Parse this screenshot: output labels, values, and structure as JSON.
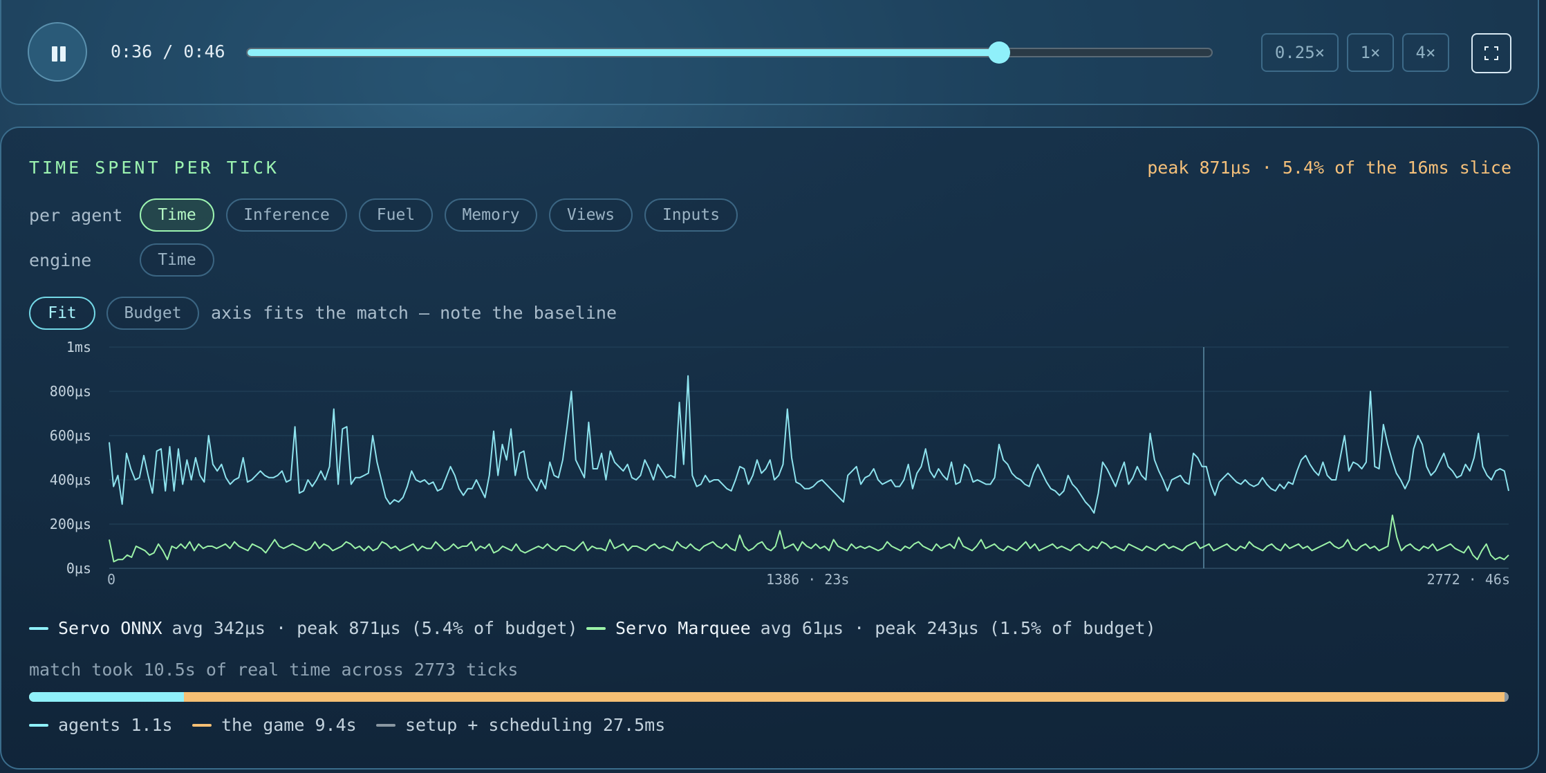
{
  "player": {
    "time_readout": "0:36 / 0:46",
    "progress": 0.78,
    "speeds": [
      {
        "label": "0.25×",
        "active": false
      },
      {
        "label": "1×",
        "active": true
      },
      {
        "label": "4×",
        "active": false
      }
    ]
  },
  "panel": {
    "title": "TIME SPENT PER TICK",
    "peak_text": "peak 871μs · 5.4% of the 16ms slice",
    "per_agent_label": "per agent",
    "per_agent_options": [
      "Time",
      "Inference",
      "Fuel",
      "Memory",
      "Views",
      "Inputs"
    ],
    "per_agent_selected": "Time",
    "engine_label": "engine",
    "engine_options": [
      "Time"
    ],
    "scale_options": [
      "Fit",
      "Budget"
    ],
    "scale_selected": "Fit",
    "scale_note": "axis fits the match — note the baseline"
  },
  "chart_data": {
    "type": "line",
    "y_ticks": [
      "1ms",
      "800μs",
      "600μs",
      "400μs",
      "200μs",
      "0μs"
    ],
    "x_ticks": [
      "0",
      "1386 · 23s",
      "2772 · 46s"
    ],
    "xlim": [
      0,
      2772
    ],
    "ylim": [
      0,
      1000
    ],
    "y_unit": "μs",
    "cursor_x": 2168,
    "grid": true,
    "series": [
      {
        "name": "Servo ONNX",
        "color": "#8ee3ee",
        "values": [
          570,
          370,
          420,
          290,
          520,
          450,
          400,
          410,
          510,
          420,
          340,
          530,
          540,
          350,
          550,
          350,
          540,
          380,
          490,
          400,
          500,
          420,
          390,
          600,
          470,
          440,
          470,
          410,
          380,
          400,
          410,
          500,
          390,
          400,
          420,
          440,
          420,
          410,
          410,
          420,
          440,
          390,
          400,
          640,
          340,
          350,
          400,
          370,
          400,
          440,
          400,
          460,
          720,
          380,
          630,
          640,
          380,
          410,
          410,
          420,
          430,
          600,
          480,
          400,
          320,
          290,
          310,
          300,
          320,
          370,
          440,
          400,
          390,
          400,
          380,
          390,
          350,
          360,
          410,
          460,
          420,
          360,
          330,
          360,
          360,
          400,
          360,
          320,
          420,
          620,
          420,
          560,
          490,
          630,
          420,
          520,
          530,
          410,
          380,
          350,
          400,
          360,
          480,
          420,
          410,
          490,
          640,
          800,
          490,
          450,
          410,
          660,
          450,
          450,
          520,
          400,
          530,
          480,
          460,
          440,
          470,
          410,
          400,
          420,
          490,
          450,
          400,
          470,
          440,
          410,
          420,
          410,
          750,
          470,
          870,
          420,
          370,
          380,
          420,
          390,
          400,
          400,
          380,
          360,
          350,
          400,
          460,
          450,
          380,
          420,
          490,
          430,
          450,
          490,
          400,
          420,
          470,
          720,
          500,
          390,
          380,
          360,
          360,
          370,
          390,
          400,
          380,
          360,
          340,
          320,
          300,
          420,
          440,
          460,
          380,
          410,
          420,
          450,
          400,
          380,
          390,
          400,
          370,
          370,
          400,
          470,
          360,
          430,
          460,
          540,
          440,
          410,
          450,
          420,
          400,
          480,
          380,
          390,
          470,
          450,
          390,
          400,
          390,
          380,
          380,
          410,
          560,
          490,
          470,
          430,
          410,
          400,
          380,
          370,
          430,
          470,
          430,
          390,
          360,
          350,
          330,
          350,
          420,
          380,
          360,
          330,
          300,
          280,
          250,
          340,
          480,
          450,
          410,
          370,
          430,
          480,
          380,
          410,
          460,
          420,
          400,
          610,
          490,
          440,
          400,
          350,
          400,
          410,
          420,
          390,
          380,
          520,
          500,
          460,
          460,
          380,
          330,
          390,
          410,
          430,
          410,
          390,
          380,
          400,
          380,
          370,
          380,
          410,
          380,
          360,
          350,
          380,
          360,
          390,
          380,
          440,
          490,
          510,
          470,
          440,
          420,
          480,
          420,
          400,
          400,
          500,
          600,
          440,
          480,
          470,
          450,
          480,
          800,
          460,
          450,
          650,
          560,
          490,
          430,
          400,
          360,
          400,
          540,
          600,
          560,
          460,
          420,
          440,
          480,
          520,
          460,
          440,
          410,
          420,
          470,
          440,
          500,
          610,
          460,
          420,
          400,
          440,
          450,
          440,
          350
        ],
        "avg": "342μs",
        "peak": "871μs",
        "budget_pct": "5.4%"
      },
      {
        "name": "Servo Marquee",
        "color": "#9cf3a8",
        "values": [
          130,
          30,
          40,
          40,
          60,
          50,
          100,
          90,
          80,
          60,
          70,
          110,
          80,
          40,
          100,
          90,
          110,
          90,
          120,
          80,
          110,
          90,
          100,
          100,
          90,
          100,
          110,
          90,
          120,
          100,
          90,
          80,
          110,
          100,
          90,
          70,
          100,
          130,
          100,
          90,
          100,
          110,
          100,
          90,
          80,
          90,
          120,
          90,
          110,
          100,
          80,
          90,
          100,
          120,
          110,
          90,
          100,
          80,
          100,
          80,
          90,
          120,
          110,
          90,
          100,
          80,
          90,
          100,
          110,
          80,
          100,
          90,
          90,
          120,
          100,
          80,
          90,
          110,
          90,
          100,
          100,
          120,
          80,
          100,
          90,
          110,
          70,
          80,
          100,
          90,
          80,
          110,
          80,
          70,
          80,
          90,
          100,
          90,
          110,
          90,
          80,
          100,
          100,
          90,
          80,
          100,
          120,
          80,
          100,
          90,
          90,
          80,
          130,
          90,
          100,
          110,
          80,
          100,
          100,
          90,
          80,
          100,
          110,
          90,
          100,
          90,
          80,
          120,
          100,
          90,
          110,
          90,
          80,
          100,
          110,
          120,
          100,
          90,
          110,
          90,
          80,
          150,
          100,
          80,
          90,
          110,
          120,
          90,
          80,
          100,
          170,
          90,
          100,
          110,
          80,
          120,
          100,
          90,
          110,
          90,
          100,
          80,
          130,
          100,
          90,
          80,
          110,
          90,
          100,
          90,
          100,
          90,
          80,
          90,
          120,
          100,
          90,
          80,
          100,
          90,
          110,
          120,
          100,
          90,
          80,
          110,
          90,
          100,
          110,
          90,
          140,
          100,
          90,
          80,
          100,
          130,
          90,
          100,
          110,
          90,
          80,
          100,
          90,
          80,
          100,
          120,
          90,
          110,
          80,
          90,
          100,
          110,
          90,
          100,
          90,
          80,
          100,
          110,
          90,
          80,
          100,
          90,
          120,
          110,
          90,
          100,
          90,
          80,
          110,
          100,
          90,
          80,
          100,
          90,
          80,
          100,
          110,
          90,
          100,
          90,
          80,
          100,
          110,
          120,
          90,
          100,
          110,
          80,
          90,
          100,
          110,
          90,
          80,
          100,
          90,
          120,
          100,
          90,
          80,
          100,
          110,
          90,
          80,
          110,
          90,
          100,
          110,
          90,
          100,
          80,
          90,
          100,
          110,
          120,
          100,
          90,
          100,
          130,
          90,
          80,
          100,
          110,
          90,
          100,
          80,
          90,
          100,
          240,
          140,
          80,
          100,
          110,
          90,
          80,
          100,
          90,
          110,
          80,
          90,
          100,
          110,
          90,
          80,
          70,
          100,
          60,
          40,
          80,
          110,
          60,
          40,
          50,
          40,
          60
        ],
        "avg": "61μs",
        "peak": "243μs",
        "budget_pct": "1.5%"
      }
    ]
  },
  "legend_text": {
    "onnx_name": "Servo ONNX",
    "onnx_stats": "avg 342μs · peak 871μs (5.4% of budget)",
    "marquee_name": "Servo Marquee",
    "marquee_stats": "avg 61μs · peak 243μs (1.5% of budget)"
  },
  "breakdown": {
    "note": "match took 10.5s of real time across 2773 ticks",
    "segments": [
      {
        "label": "agents 1.1s",
        "value_s": 1.1,
        "color": "#8ff0fa"
      },
      {
        "label": "the game 9.4s",
        "value_s": 9.4,
        "color": "#f5bf74"
      },
      {
        "label": "setup + scheduling 27.5ms",
        "value_s": 0.0275,
        "color": "#8a97a2"
      }
    ]
  }
}
